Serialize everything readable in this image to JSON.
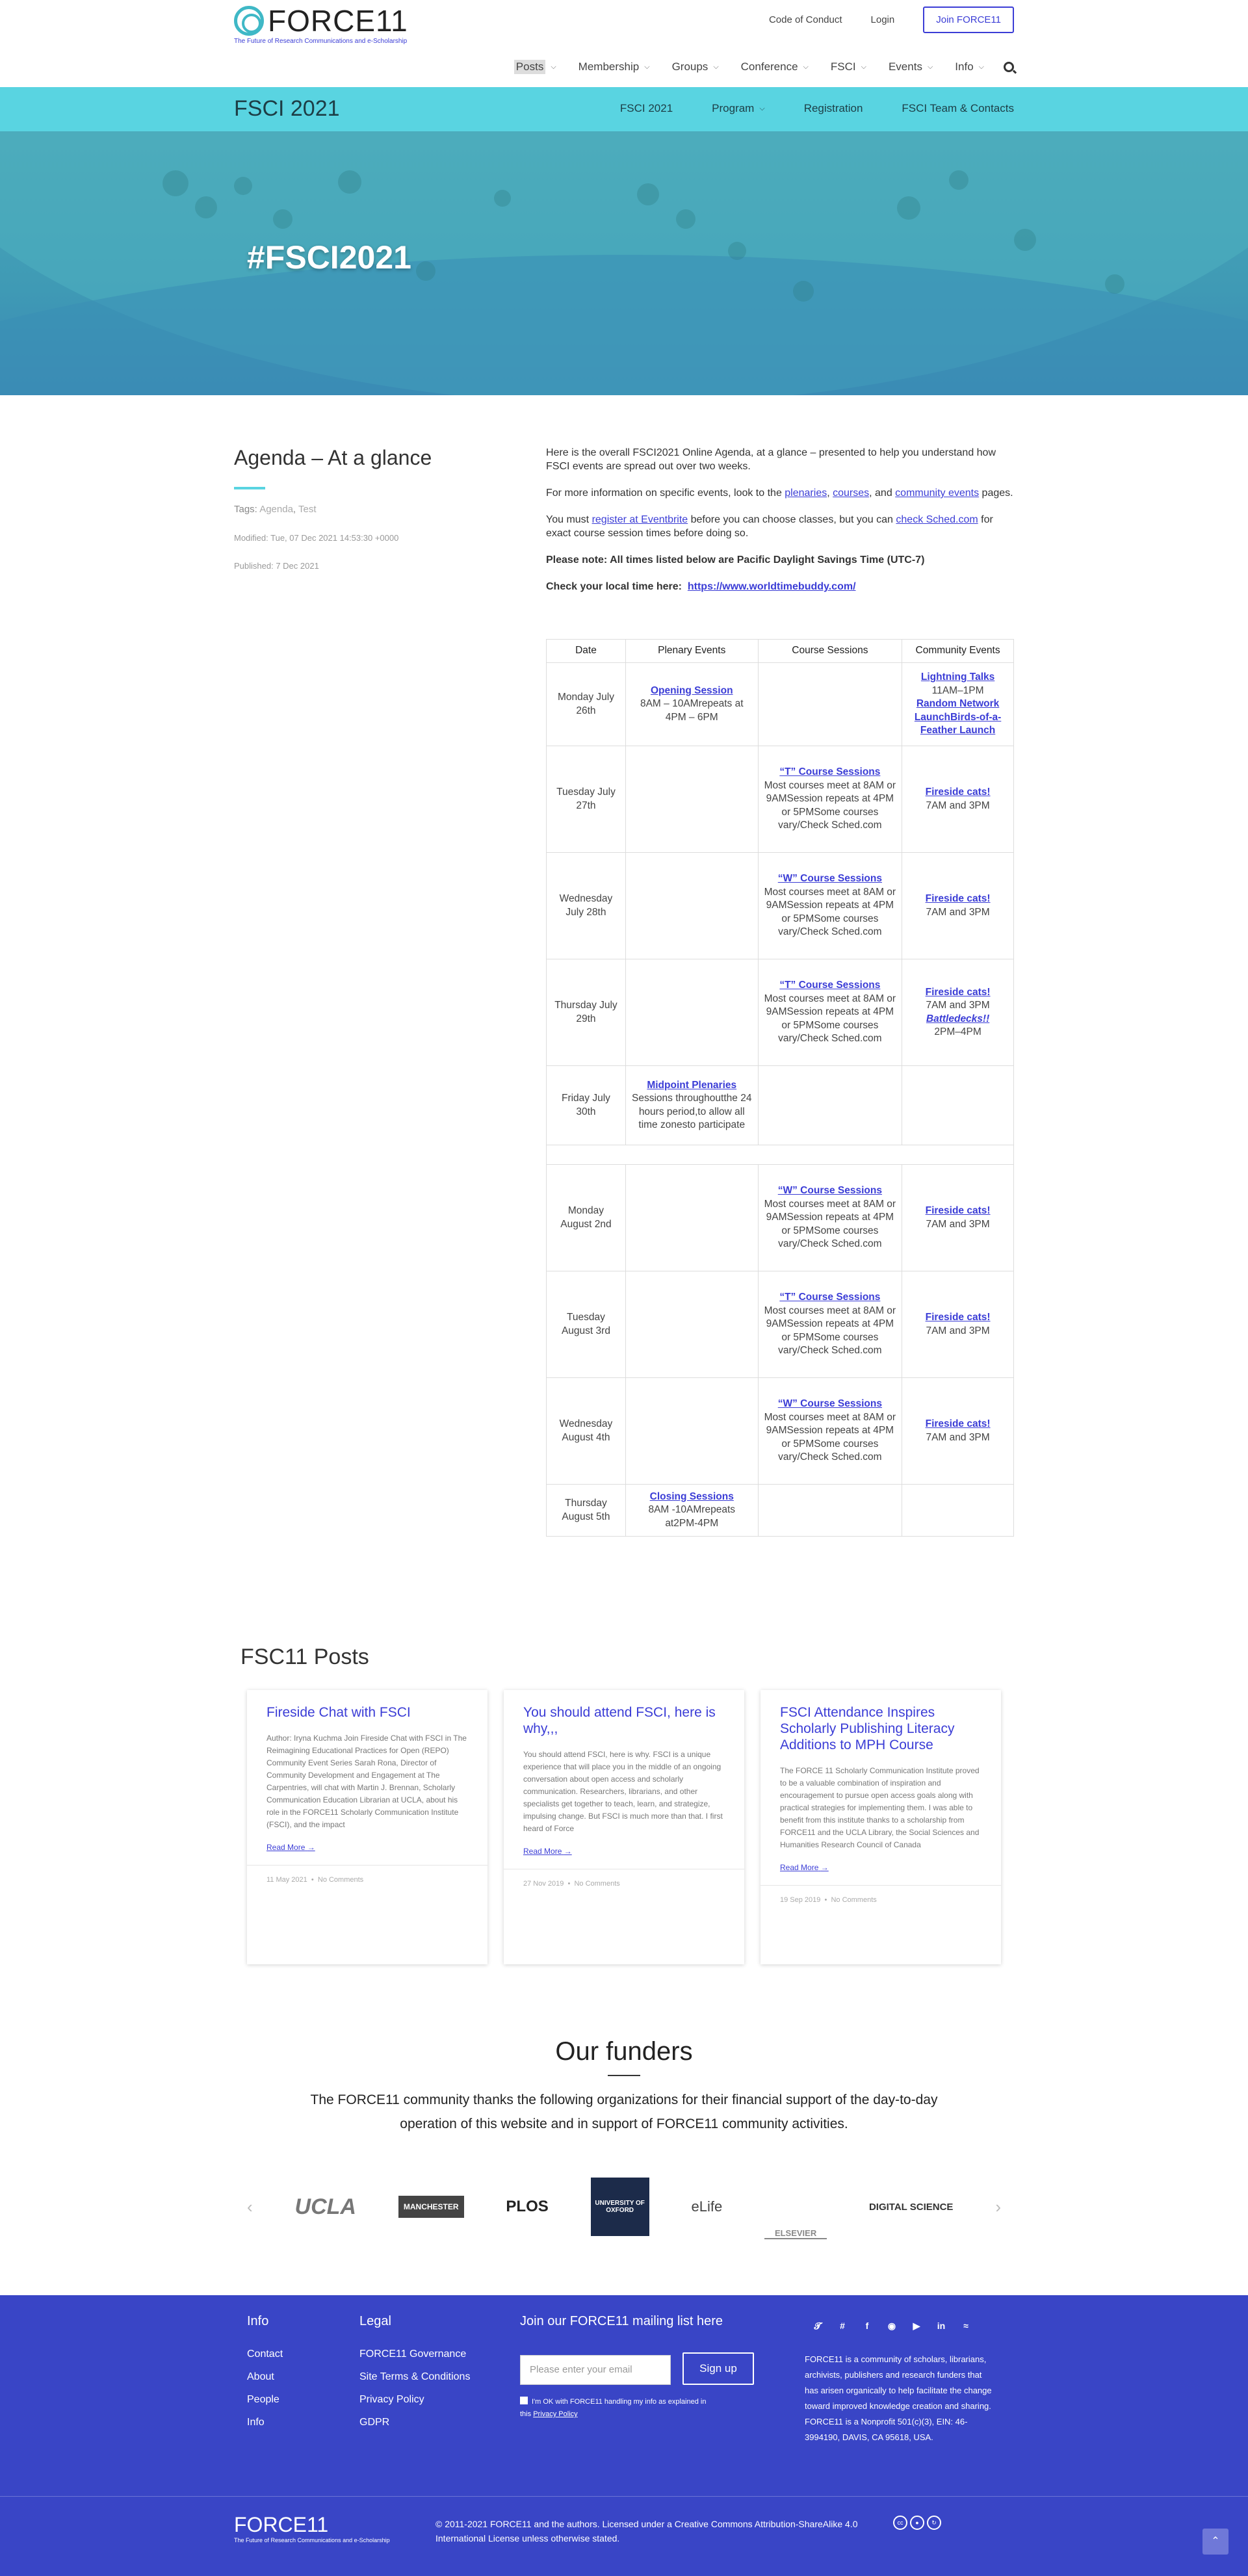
{
  "header": {
    "logo_text": "FORCE11",
    "logo_tagline": "The Future of Research Communications and e-Scholarship",
    "top_links": [
      "Code of Conduct",
      "Login"
    ],
    "join_label": "Join FORCE11",
    "nav": [
      "Posts",
      "Membership",
      "Groups",
      "Conference",
      "FSCI",
      "Events",
      "Info"
    ]
  },
  "subbar": {
    "title": "FSCI 2021",
    "nav": [
      "FSCI 2021",
      "Program",
      "Registration",
      "FSCI Team & Contacts"
    ]
  },
  "hero": {
    "title": "#FSCI2021"
  },
  "article": {
    "title": "Agenda – At a glance",
    "tags_label": "Tags:",
    "tags": [
      "Agenda",
      "Test"
    ],
    "modified": "Modified: Tue, 07 Dec 2021 14:53:30 +0000",
    "published": "Published: 7 Dec 2021",
    "p1": "Here is the overall FSCI2021 Online Agenda, at a glance – presented to help you understand how FSCI events are spread out over two weeks.",
    "p2_a": "For more information on specific events, look to the ",
    "p2_l1": "plenaries",
    "p2_b": ", ",
    "p2_l2": "courses",
    "p2_c": ", and ",
    "p2_l3": "community events",
    "p2_d": " pages.",
    "p3_a": "You must ",
    "p3_l1": "register at Eventbrite",
    "p3_b": " before you can choose classes, but you can ",
    "p3_l2": "check Sched.com",
    "p3_c": " for exact course session times before doing so.",
    "p4": "Please note: All times listed below are Pacific Daylight Savings Time (UTC-7)",
    "p5_a": "Check your local time here:",
    "p5_l": "https://www.worldtimebuddy.com/"
  },
  "agenda": {
    "headers": [
      "Date",
      "Plenary Events",
      "Course Sessions",
      "Community Events"
    ],
    "course_note": "Most courses meet at 8AM or 9AMSession repeats at 4PM or 5PMSome courses vary/Check Sched.com",
    "rows": {
      "r1": {
        "date": "Monday July 26th",
        "plen_link": "Opening Session",
        "plen_text": "8AM – 10AMrepeats at 4PM – 6PM",
        "c1": "Lightning Talks",
        "c1t": "11AM–1PM",
        "c2": "Random Network LaunchBirds-of-a-Feather Launch"
      },
      "r2": {
        "date": "Tuesday July 27th",
        "course": "“T” Course Sessions",
        "comm": "Fireside cats!",
        "commt": "7AM and 3PM"
      },
      "r3": {
        "date": "Wednesday July 28th",
        "course": "“W” Course Sessions",
        "comm": "Fireside cats!",
        "commt": "7AM and 3PM"
      },
      "r4": {
        "date": "Thursday July 29th",
        "course": "“T” Course Sessions",
        "comm": "Fireside cats!",
        "commt": "7AM and 3PM",
        "comm2": "Battledecks!!",
        "comm2t": "2PM–4PM"
      },
      "r5": {
        "date": "Friday July 30th",
        "plen_link": "Midpoint Plenaries",
        "plen_text": "Sessions throughoutthe 24 hours period,to allow all time zonesto participate"
      },
      "r6": {
        "date": "Monday August 2nd",
        "course": "“W” Course Sessions",
        "comm": "Fireside cats!",
        "commt": "7AM and 3PM"
      },
      "r7": {
        "date": "Tuesday August 3rd",
        "course": "“T” Course Sessions",
        "comm": "Fireside cats!",
        "commt": "7AM and 3PM"
      },
      "r8": {
        "date": "Wednesday August 4th",
        "course": "“W” Course Sessions",
        "comm": "Fireside cats!",
        "commt": "7AM and 3PM"
      },
      "r9": {
        "date": "Thursday August 5th",
        "plen_link": "Closing Sessions",
        "plen_text": "8AM -10AMrepeats at2PM-4PM"
      }
    }
  },
  "posts": {
    "heading": "FSC11 Posts",
    "read_more": "Read More",
    "cards": [
      {
        "title": "Fireside Chat with FSCI",
        "excerpt": "Author: Iryna Kuchma Join Fireside Chat with FSCI in The Reimagining Educational Practices for Open (REPO) Community Event Series Sarah Rona, Director of Community Development and Engagement at The Carpentries, will chat with Martin J. Brennan, Scholarly Communication Education Librarian at UCLA, about his role in the FORCE11 Scholarly Communication Institute (FSCI), and the impact",
        "date": "11 May 2021",
        "comments": "No Comments"
      },
      {
        "title": "You should attend FSCI, here is why,,,",
        "excerpt": "You should attend FSCI, here is why. FSCI is a unique experience that will place you in the middle of an ongoing conversation about open access and scholarly communication. Researchers, librarians, and other specialists get together to teach, learn, and strategize, impulsing change. But FSCI is much more than that. I first heard of Force",
        "date": "27 Nov 2019",
        "comments": "No Comments"
      },
      {
        "title": "FSCI Attendance Inspires Scholarly Publishing Literacy Additions to MPH Course",
        "excerpt": "The FORCE 11 Scholarly Communication Institute proved to be a valuable combination of inspiration and encouragement to pursue open access goals along with practical strategies for implementing them. I was able to benefit from this institute thanks to a scholarship from FORCE11 and the UCLA Library, the Social Sciences and Humanities Research Council of Canada",
        "date": "19 Sep 2019",
        "comments": "No Comments"
      }
    ]
  },
  "funders": {
    "heading": "Our funders",
    "text": "The FORCE11 community thanks the following organizations for their financial support of the day-to-day operation of this website and in support of FORCE11 community activities.",
    "logos": [
      "UCLA",
      "MANCHESTER",
      "PLOS",
      "UNIVERSITY OF OXFORD",
      "eLife",
      "ELSEVIER",
      "DIGITAL SCIENCE"
    ]
  },
  "footer": {
    "info_heading": "Info",
    "info_links": [
      "Contact",
      "About",
      "People",
      "Info"
    ],
    "legal_heading": "Legal",
    "legal_links": [
      "FORCE11 Governance",
      "Site Terms & Conditions",
      "Privacy Policy",
      "GDPR"
    ],
    "mail_heading": "Join our FORCE11 mailing list here",
    "mail_placeholder": "Please enter your email",
    "signup_label": "Sign up",
    "consent_a": "I'm OK with FORCE11 handling my info as explained in this ",
    "consent_link": "Privacy Policy",
    "about": "FORCE11 is a community of scholars, librarians, archivists, publishers and research funders that has arisen organically to help facilitate the change toward improved knowledge creation and sharing. FORCE11 is a Nonprofit 501(c)(3), EIN: 46-3994190, DAVIS, CA 95618, USA.",
    "license": "© 2011-2021 FORCE11 and the authors. Licensed under a Creative Commons Attribution-ShareAlike 4.0 International License unless otherwise stated.",
    "social_icons": [
      "twitter-icon",
      "slack-icon",
      "facebook-icon",
      "github-icon",
      "youtube-icon",
      "linkedin-icon",
      "rss-icon"
    ]
  }
}
